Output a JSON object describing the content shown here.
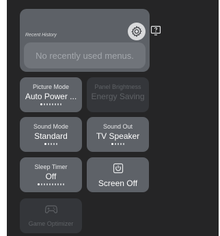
{
  "history": {
    "title": "Recent History",
    "empty_message": "No recently used menus."
  },
  "icons": {
    "settings": "gear-icon",
    "help": "help-icon",
    "screen_off": "power-icon",
    "game_optimizer": "gamepad-icon"
  },
  "tiles": [
    {
      "label": "Picture Mode",
      "value": "Auto Power ...",
      "dots_total": 8,
      "dots_active": 1,
      "enabled": true
    },
    {
      "label": "Panel Brightness",
      "value": "Energy Saving",
      "enabled": false
    },
    {
      "label": "Sound Mode",
      "value": "Standard",
      "dots_total": 5,
      "dots_active": 1,
      "enabled": true
    },
    {
      "label": "Sound Out",
      "value": "TV Speaker",
      "dots_total": 5,
      "dots_active": 1,
      "enabled": true
    },
    {
      "label": "Sleep Timer",
      "value": "Off",
      "dots_total": 10,
      "dots_active": 1,
      "enabled": true
    },
    {
      "label": "Screen Off",
      "enabled": true
    },
    {
      "label": "Game Optimizer",
      "enabled": false
    }
  ]
}
